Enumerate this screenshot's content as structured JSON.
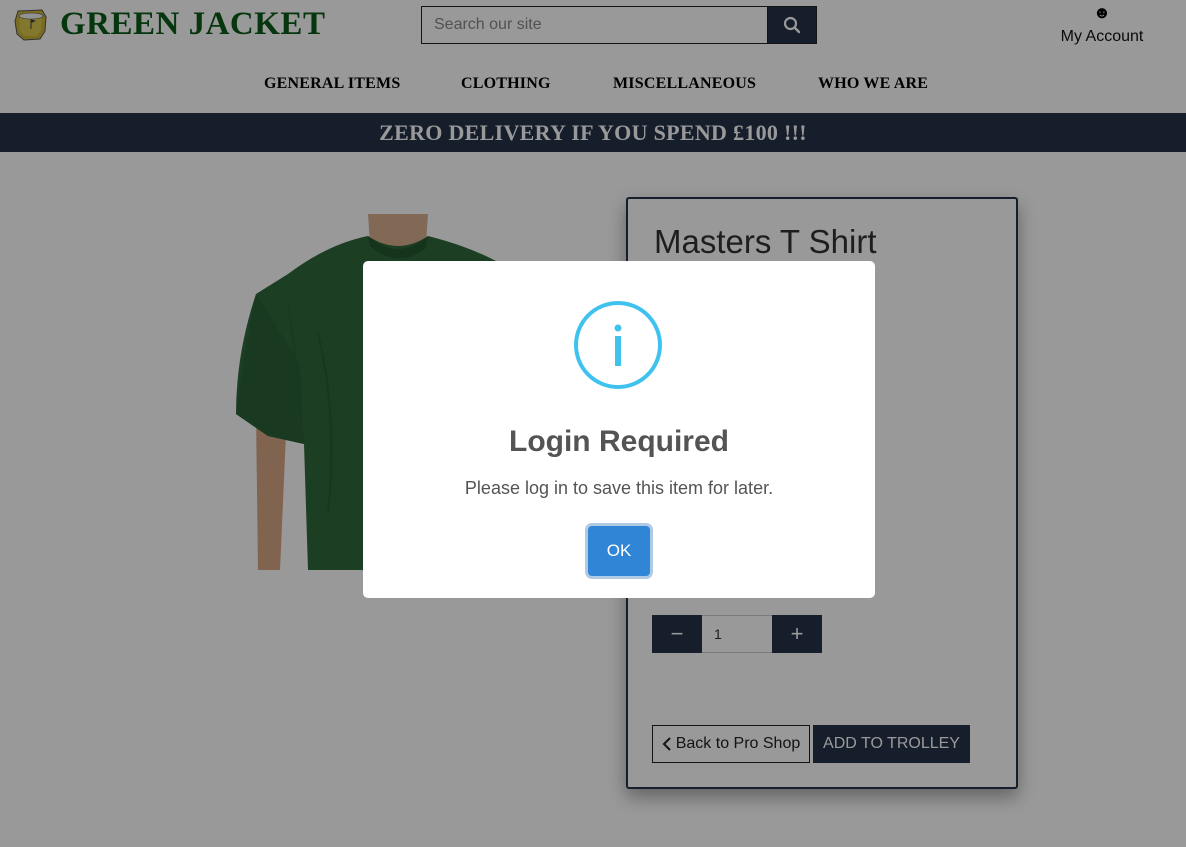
{
  "header": {
    "brand": "GREEN JACKET",
    "logo_icon": "masters-logo-icon",
    "search": {
      "placeholder": "Search our site",
      "icon": "search-icon"
    },
    "account": {
      "icon": "smiley-icon",
      "glyph": "☻",
      "label": "My Account"
    }
  },
  "nav": {
    "items": [
      {
        "label": "GENERAL ITEMS"
      },
      {
        "label": "CLOTHING"
      },
      {
        "label": "MISCELLANEOUS"
      },
      {
        "label": "WHO WE ARE"
      }
    ]
  },
  "banner": {
    "text": "ZERO DELIVERY IF YOU SPEND £100 !!!"
  },
  "product": {
    "title": "Masters T Shirt",
    "quantity": "1",
    "decrement_glyph": "−",
    "increment_glyph": "+",
    "back_label": "Back to Pro Shop",
    "add_label": "ADD TO TROLLEY"
  },
  "modal": {
    "icon": "info-icon",
    "title": "Login Required",
    "text": "Please log in to save this item for later.",
    "ok_label": "OK"
  },
  "colors": {
    "navy": "#233247",
    "brand_green": "#0b5a16",
    "info_blue": "#3fc3ee",
    "ok_blue": "#3085d6"
  }
}
